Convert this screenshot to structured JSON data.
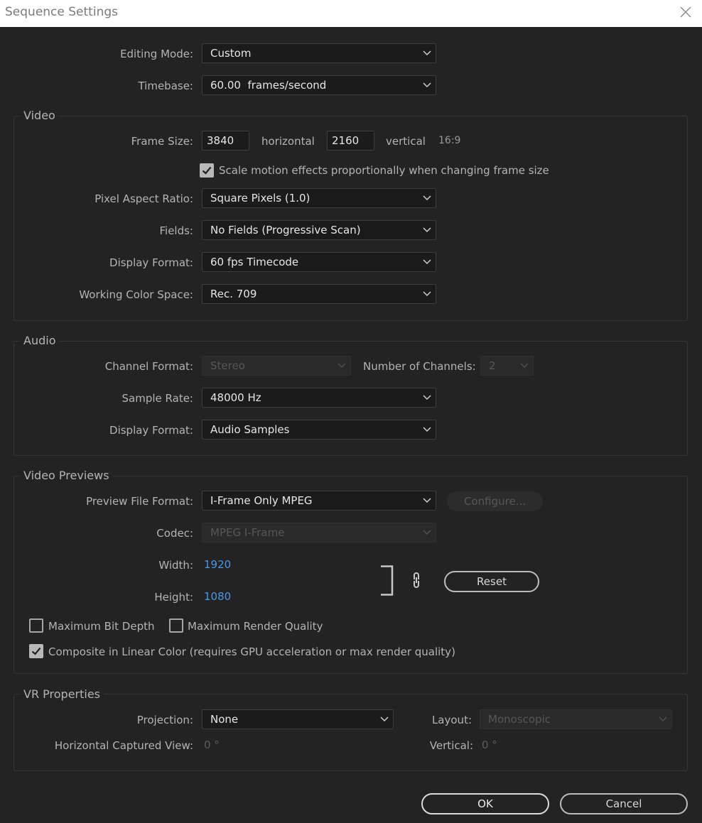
{
  "window": {
    "title": "Sequence Settings"
  },
  "general": {
    "editing_mode_label": "Editing Mode:",
    "editing_mode_value": "Custom",
    "timebase_label": "Timebase:",
    "timebase_value": "60.00  frames/second"
  },
  "video": {
    "group_title": "Video",
    "frame_size_label": "Frame Size:",
    "frame_width": "3840",
    "horizontal_label": "horizontal",
    "frame_height": "2160",
    "vertical_label": "vertical",
    "aspect": "16:9",
    "scale_motion_label": "Scale motion effects proportionally when changing frame size",
    "scale_motion_checked": true,
    "pixel_aspect_label": "Pixel Aspect Ratio:",
    "pixel_aspect_value": "Square Pixels (1.0)",
    "fields_label": "Fields:",
    "fields_value": "No Fields (Progressive Scan)",
    "display_format_label": "Display Format:",
    "display_format_value": "60 fps Timecode",
    "color_space_label": "Working Color Space:",
    "color_space_value": "Rec. 709"
  },
  "audio": {
    "group_title": "Audio",
    "channel_format_label": "Channel Format:",
    "channel_format_value": "Stereo",
    "num_channels_label": "Number of Channels:",
    "num_channels_value": "2",
    "sample_rate_label": "Sample Rate:",
    "sample_rate_value": "48000 Hz",
    "display_format_label": "Display Format:",
    "display_format_value": "Audio Samples"
  },
  "previews": {
    "group_title": "Video Previews",
    "file_format_label": "Preview File Format:",
    "file_format_value": "I-Frame Only MPEG",
    "configure_label": "Configure...",
    "codec_label": "Codec:",
    "codec_value": "MPEG I-Frame",
    "width_label": "Width:",
    "width_value": "1920",
    "height_label": "Height:",
    "height_value": "1080",
    "reset_label": "Reset",
    "max_bit_depth_label": "Maximum Bit Depth",
    "max_bit_depth_checked": false,
    "max_render_quality_label": "Maximum Render Quality",
    "max_render_quality_checked": false,
    "composite_linear_label": "Composite in Linear Color (requires GPU acceleration or max render quality)",
    "composite_linear_checked": true
  },
  "vr": {
    "group_title": "VR Properties",
    "projection_label": "Projection:",
    "projection_value": "None",
    "layout_label": "Layout:",
    "layout_value": "Monoscopic",
    "h_view_label": "Horizontal Captured View:",
    "h_view_value": "0 °",
    "vertical_label": "Vertical:",
    "vertical_value": "0 °"
  },
  "buttons": {
    "ok": "OK",
    "cancel": "Cancel"
  },
  "colors": {
    "background": "#232323",
    "link": "#4a98e6",
    "field": "#1b1b1b"
  }
}
